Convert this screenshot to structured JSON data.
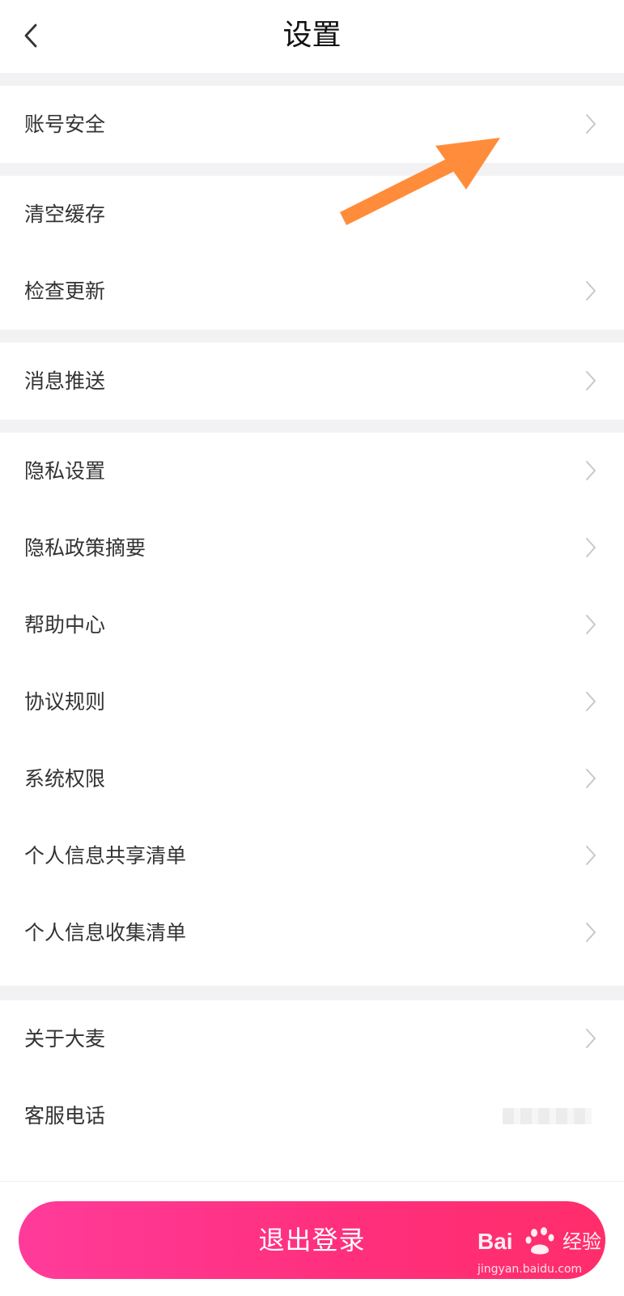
{
  "header": {
    "title": "设置",
    "back_icon": "chevron-left-icon"
  },
  "settings": {
    "groups": [
      {
        "items": [
          {
            "label": "账号安全",
            "icon": "chevron-right-icon"
          }
        ]
      },
      {
        "items": [
          {
            "label": "清空缓存",
            "icon": ""
          },
          {
            "label": "检查更新",
            "icon": "chevron-right-icon"
          }
        ]
      },
      {
        "items": [
          {
            "label": "消息推送",
            "icon": "chevron-right-icon"
          }
        ]
      },
      {
        "items": [
          {
            "label": "隐私设置",
            "icon": "chevron-right-icon"
          },
          {
            "label": "隐私政策摘要",
            "icon": "chevron-right-icon"
          },
          {
            "label": "帮助中心",
            "icon": "chevron-right-icon"
          },
          {
            "label": "协议规则",
            "icon": "chevron-right-icon"
          },
          {
            "label": "系统权限",
            "icon": "chevron-right-icon"
          },
          {
            "label": "个人信息共享清单",
            "icon": "chevron-right-icon"
          },
          {
            "label": "个人信息收集清单",
            "icon": "chevron-right-icon"
          }
        ]
      },
      {
        "items": [
          {
            "label": "关于大麦",
            "icon": "chevron-right-icon"
          },
          {
            "label": "客服电话",
            "icon": ""
          }
        ]
      }
    ]
  },
  "logout": {
    "label": "退出登录"
  },
  "watermark": {
    "brand": "Bai",
    "brand_suffix": "经验",
    "url": "jingyan.baidu.com"
  },
  "colors": {
    "accent_start": "#ff3b9a",
    "accent_end": "#ff2d6a",
    "annotation_arrow": "#ff8c3a",
    "divider": "#f2f2f4"
  }
}
